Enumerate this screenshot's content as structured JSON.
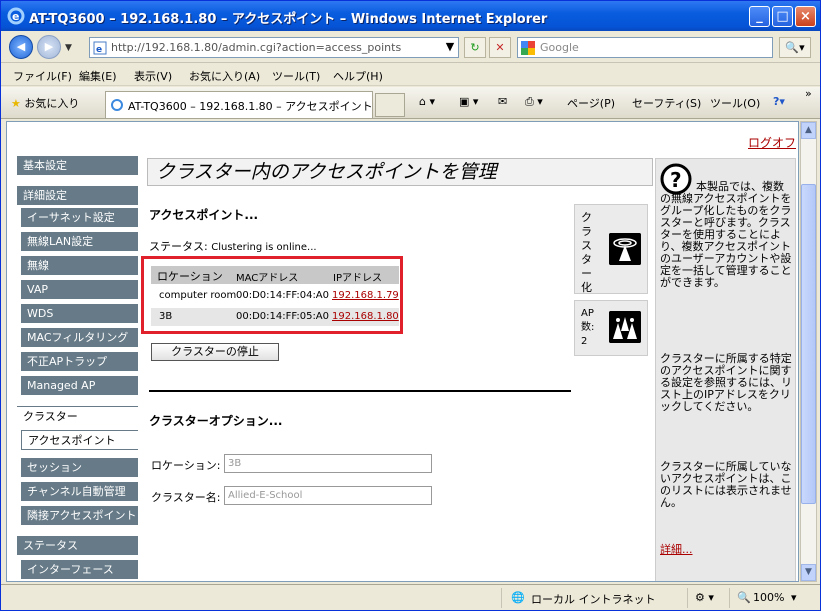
{
  "window": {
    "title": "AT-TQ3600 – 192.168.1.80 – アクセスポイント – Windows Internet Explorer"
  },
  "address": {
    "url": "http://192.168.1.80/admin.cgi?action=access_points",
    "search_placeholder": "Google"
  },
  "menu": [
    "ファイル(F)",
    "編集(E)",
    "表示(V)",
    "お気に入り(A)",
    "ツール(T)",
    "ヘルプ(H)"
  ],
  "tabs": {
    "favorites": "お気に入り",
    "active_tab": "AT-TQ3600 – 192.168.1.80 – アクセスポイント"
  },
  "commands": {
    "page": "ページ(P)",
    "safety": "セーフティ(S)",
    "tools": "ツール(O)",
    "more": "»"
  },
  "logout": "ログオフ",
  "sidebar": [
    {
      "label": "基本設定",
      "kind": "head"
    },
    {
      "label": "詳細設定",
      "kind": "head"
    },
    {
      "label": "イーサネット設定",
      "kind": "sub"
    },
    {
      "label": "無線LAN設定",
      "kind": "sub"
    },
    {
      "label": "無線",
      "kind": "sub"
    },
    {
      "label": "VAP",
      "kind": "sub"
    },
    {
      "label": "WDS",
      "kind": "sub"
    },
    {
      "label": "MACフィルタリング",
      "kind": "sub"
    },
    {
      "label": "不正APトラップ",
      "kind": "sub"
    },
    {
      "label": "Managed AP",
      "kind": "sub"
    },
    {
      "label": "クラスター",
      "kind": "whitehead"
    },
    {
      "label": "アクセスポイント",
      "kind": "active"
    },
    {
      "label": "セッション",
      "kind": "sub"
    },
    {
      "label": "チャンネル自動管理",
      "kind": "sub"
    },
    {
      "label": "隣接アクセスポイント",
      "kind": "sub"
    },
    {
      "label": "ステータス",
      "kind": "head"
    },
    {
      "label": "インターフェース",
      "kind": "sub"
    }
  ],
  "main": {
    "page_title": "クラスター内のアクセスポイントを管理",
    "section_ap": "アクセスポイント...",
    "status_label": "ステータス:",
    "status_value": "Clustering is online...",
    "table": {
      "headers": [
        "ロケーション",
        "MACアドレス",
        "IPアドレス"
      ],
      "rows": [
        [
          "computer room",
          "00:D0:14:FF:04:A0",
          "192.168.1.79"
        ],
        [
          "3B",
          "00:D0:14:FF:05:A0",
          "192.168.1.80"
        ]
      ]
    },
    "stop_button": "クラスターの停止",
    "section_options": "クラスターオプション...",
    "location_label": "ロケーション:",
    "location_value": "3B",
    "cluster_label": "クラスター名:",
    "cluster_value": "Allied-E-School"
  },
  "cards": {
    "cluster": "クラスター化",
    "ap_count": "AP数: 2"
  },
  "help": {
    "p1": "本製品では、複数の無線アクセスポイントをグループ化したものをクラスターと呼びます。クラスターを使用することにより、複数アクセスポイントのユーザーアカウントや設定を一括して管理することができます。",
    "p2": "クラスターに所属する特定のアクセスポイントに関する設定を参照するには、リスト上のIPアドレスをクリックしてください。",
    "p3": "クラスターに所属していないアクセスポイントは、このリストには表示されません。",
    "more": "詳細..."
  },
  "statusbar": {
    "zone": "ローカル イントラネット",
    "zoom": "100%"
  }
}
